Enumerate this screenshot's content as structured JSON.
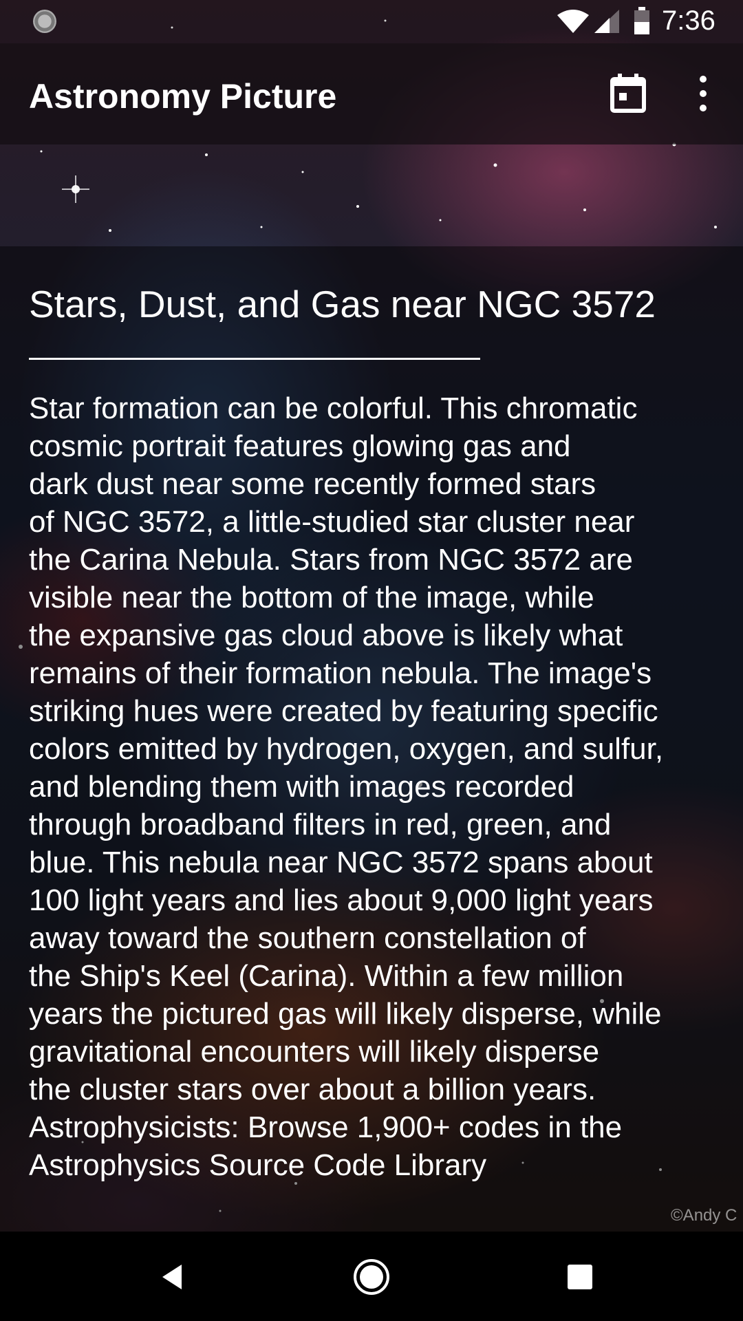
{
  "status_bar": {
    "time": "7:36",
    "icons": [
      "sync-icon",
      "wifi-icon",
      "cellular-signal-icon",
      "battery-icon"
    ]
  },
  "app_bar": {
    "title": "Astronomy Picture",
    "actions": [
      "calendar-icon",
      "more-vert-icon"
    ]
  },
  "article": {
    "title": "Stars, Dust, and Gas near NGC 3572",
    "description": "Star formation can be colorful.  This chromatic\ncosmic portrait features glowing gas and\ndark dust near some recently formed stars\nof NGC 3572, a little-studied star cluster near\nthe Carina Nebula.  Stars from NGC 3572 are\nvisible near the bottom of the image, while\nthe expansive gas cloud above is likely what\nremains of their formation nebula. The image's\nstriking hues were created by featuring specific\ncolors emitted by hydrogen, oxygen, and sulfur,\nand blending them with images recorded\nthrough broadband filters in red, green, and\nblue. This nebula near NGC 3572 spans about\n100 light years and lies about 9,000 light years\naway toward the southern constellation of\nthe Ship's Keel (Carina).  Within a few million\nyears the pictured gas will likely disperse, while\ngravitational encounters will likely disperse\nthe cluster stars over about a billion years.\nAstrophysicists: Browse 1,900+ codes in the\nAstrophysics Source Code Library",
    "credit": "©Andy C"
  },
  "nav_bar": {
    "buttons": [
      "back-icon",
      "home-icon",
      "recents-icon"
    ]
  }
}
